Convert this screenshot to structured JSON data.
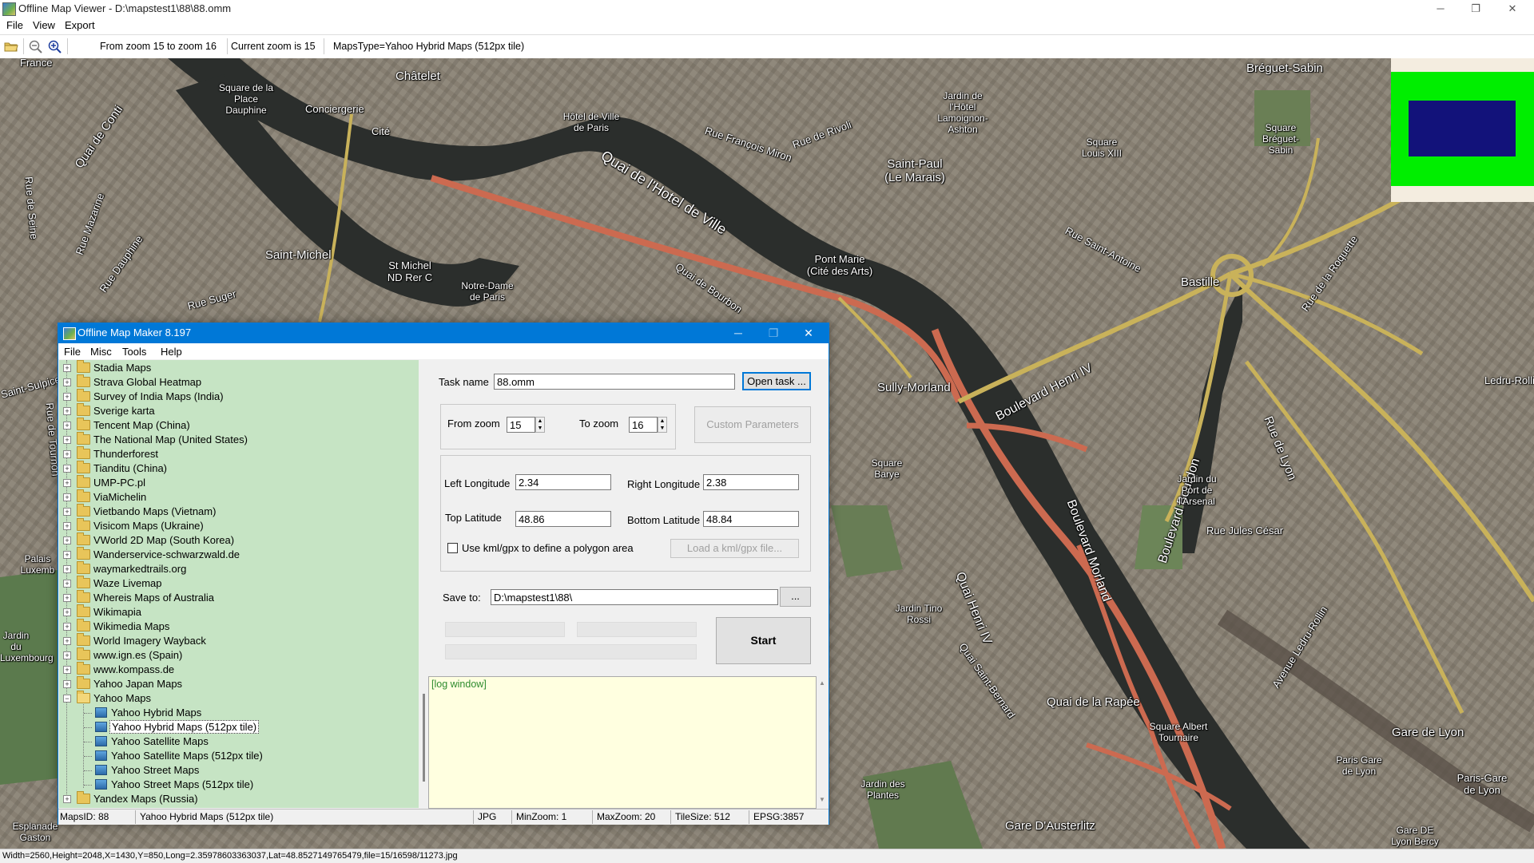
{
  "window": {
    "title": "Offline Map Viewer - D:\\mapstest1\\88\\88.omm",
    "minimize": "─",
    "maximize": "❐",
    "close": "✕"
  },
  "menu": {
    "file": "File",
    "view": "View",
    "export": "Export"
  },
  "toolbar": {
    "zoom_range": "From zoom 15 to zoom 16",
    "current_zoom": "Current zoom is 15",
    "maps_type": "MapsType=Yahoo Hybrid Maps (512px tile)"
  },
  "map_labels": [
    "France",
    "Châtelet",
    "Square de la Place Dauphine",
    "Conciergerie",
    "Cité",
    "Hôtel de Ville de Paris",
    "Quai de l'Hotel de Ville",
    "Rue François Miron",
    "Rue de Rivoli",
    "Saint-Paul (Le Marais)",
    "Jardin de l'Hôtel Lamoignon-Ashton",
    "Square Louis XIII",
    "Bréguet-Sabin",
    "Square Bréguet-Sabin",
    "Saint-Michel",
    "St Michel ND Rer C",
    "Notre-Dame de Paris",
    "Quai de Bourbon",
    "Pont Marie (Cité des Arts)",
    "Rue Saint-Antoine",
    "Bastille",
    "Rue de la Roquette",
    "Quai de Conti",
    "Rue Mazarine",
    "Rue Dauphine",
    "Rue Suger",
    "Sully-Morland",
    "Boulevard Henri IV",
    "Boulevard Bourdon",
    "Rue de Lyon",
    "Ledru-Rollin",
    "Jardin du Port de l'Arsenal",
    "Rue Jules César",
    "Square Barye",
    "Boulevard Morland",
    "Quai Henri IV",
    "Jardin Tino Rossi",
    "Quai Saint-Bernard",
    "Quai de la Rapée",
    "Square Albert Tournaire",
    "Avenue Ledru-Rollin",
    "Gare de Lyon",
    "Paris Gare de Lyon",
    "Paris-Gare de Lyon",
    "Jardin des Plantes",
    "Gare D'Austerlitz",
    "Gare DE Lyon Bercy",
    "Esplanade Gaston",
    "Palais Luxemb",
    "Jardin du Luxembourg",
    "Rue de Tournon",
    "Saint-Sulpice",
    "Rue de Seine"
  ],
  "statusbar": "Width=2560,Height=2048,X=1430,Y=850,Long=2.35978603363037,Lat=48.8527149765479,file=15/16598/11273.jpg",
  "dialog": {
    "title": "Offline Map Maker 8.197",
    "menu": {
      "file": "File",
      "misc": "Misc",
      "tools": "Tools",
      "help": "Help"
    },
    "tree": {
      "folders_before": [
        "Stadia Maps",
        "Strava Global Heatmap",
        "Survey of India Maps (India)",
        "Sverige karta",
        "Tencent Map (China)",
        "The National Map (United States)",
        "Thunderforest",
        "Tianditu (China)",
        "UMP-PC.pl",
        "ViaMichelin",
        "Vietbando Maps (Vietnam)",
        "Visicom Maps (Ukraine)",
        "VWorld 2D Map (South Korea)",
        "Wanderservice-schwarzwald.de",
        "waymarkedtrails.org",
        "Waze Livemap",
        "Whereis Maps of Australia",
        "Wikimapia",
        "Wikimedia Maps",
        "World Imagery Wayback",
        "www.ign.es (Spain)",
        "www.kompass.de",
        "Yahoo Japan Maps"
      ],
      "expanded_folder": "Yahoo Maps",
      "children": [
        "Yahoo Hybrid Maps",
        "Yahoo Hybrid Maps (512px tile)",
        "Yahoo Satellite Maps",
        "Yahoo Satellite Maps (512px tile)",
        "Yahoo Street Maps",
        "Yahoo Street Maps (512px tile)"
      ],
      "selected": "Yahoo Hybrid Maps (512px tile)",
      "folders_after": [
        "Yandex Maps (Russia)"
      ]
    },
    "task_name_label": "Task name",
    "task_name_value": "88.omm",
    "open_task": "Open task ...",
    "from_zoom_label": "From zoom",
    "from_zoom_value": "15",
    "to_zoom_label": "To zoom",
    "to_zoom_value": "16",
    "custom_parameters": "Custom Parameters",
    "left_longitude_label": "Left Longitude",
    "left_longitude_value": "2.34",
    "right_longitude_label": "Right Longitude",
    "right_longitude_value": "2.38",
    "top_latitude_label": "Top Latitude",
    "top_latitude_value": "48.86",
    "bottom_latitude_label": "Bottom Latitude",
    "bottom_latitude_value": "48.84",
    "use_kml_label": "Use kml/gpx to define a polygon area",
    "load_kml": "Load a kml/gpx file...",
    "save_to_label": "Save to:",
    "save_to_value": "D:\\mapstest1\\88\\",
    "browse": "...",
    "start": "Start",
    "log": "[log window]",
    "status": {
      "maps_id": "MapsID: 88",
      "maps_name": "Yahoo Hybrid Maps (512px tile)",
      "format": "JPG",
      "min_zoom": "MinZoom: 1",
      "max_zoom": "MaxZoom: 20",
      "tile_size": "TileSize: 512",
      "epsg": "EPSG:3857"
    }
  },
  "colors": {
    "accent": "#0078d7",
    "tree_bg": "#c6e4c4",
    "log_bg": "#ffffe0",
    "overview_green": "#00ee00",
    "overview_blue": "#12127a"
  }
}
